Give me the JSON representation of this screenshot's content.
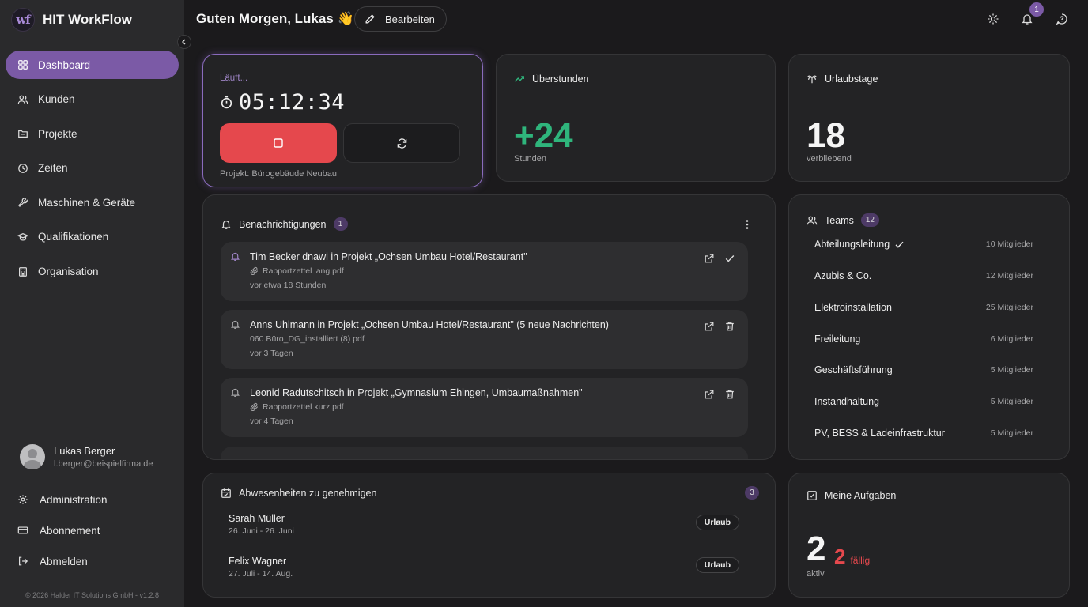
{
  "brand": {
    "logo_text": "wf",
    "name": "HIT WorkFlow"
  },
  "sidebar": {
    "items": [
      {
        "label": "Dashboard",
        "icon": "grid-icon",
        "active": true
      },
      {
        "label": "Kunden",
        "icon": "users-icon"
      },
      {
        "label": "Projekte",
        "icon": "folder-icon"
      },
      {
        "label": "Zeiten",
        "icon": "clock-icon"
      },
      {
        "label": "Maschinen & Geräte",
        "icon": "wrench-icon"
      },
      {
        "label": "Qualifikationen",
        "icon": "graduation-cap-icon"
      },
      {
        "label": "Organisation",
        "icon": "building-icon"
      }
    ],
    "user": {
      "name": "Lukas Berger",
      "email": "l.berger@beispielfirma.de"
    },
    "bottom": [
      {
        "label": "Administration",
        "icon": "gear-icon"
      },
      {
        "label": "Abonnement",
        "icon": "credit-card-icon"
      },
      {
        "label": "Abmelden",
        "icon": "logout-icon"
      }
    ],
    "copyright": "© 2026 Halder IT Solutions GmbH - v1.2.8"
  },
  "header": {
    "greeting": "Guten Morgen, Lukas 👋",
    "edit_label": "Bearbeiten",
    "notification_count": "1"
  },
  "timer": {
    "status": "Läuft...",
    "value": "05:12:34",
    "project": "Projekt: Bürogebäude Neubau"
  },
  "overtime": {
    "title": "Überstunden",
    "value": "+24",
    "sub": "Stunden"
  },
  "vacation": {
    "title": "Urlaubstage",
    "value": "18",
    "sub": "verbliebend"
  },
  "notifications": {
    "title": "Benachrichtigungen",
    "count": "1",
    "items": [
      {
        "title": "Tim Becker dnawi in Projekt „Ochsen Umbau Hotel/Restaurant\"",
        "file": "Rapportzettel lang.pdf",
        "time": "vor etwa 18 Stunden",
        "action": "check"
      },
      {
        "title": "Anns Uhlmann in Projekt „Ochsen Umbau Hotel/Restaurant\" (5 neue Nachrichten)",
        "file": "060 Büro_DG_installiert (8) pdf",
        "time": "vor 3 Tagen",
        "action": "trash"
      },
      {
        "title": "Leonid Radutschitsch in Projekt „Gymnasium Ehingen, Umbaumaßnahmen\"",
        "file": "Rapportzettel kurz.pdf",
        "time": "vor 4 Tagen",
        "action": "trash"
      }
    ]
  },
  "teams": {
    "title": "Teams",
    "count": "12",
    "items": [
      {
        "name": "Abteilungsleitung",
        "members": "10 Mitglieder",
        "selected": true
      },
      {
        "name": "Azubis & Co.",
        "members": "12 Mitglieder"
      },
      {
        "name": "Elektroinstallation",
        "members": "25 Mitglieder"
      },
      {
        "name": "Freileitung",
        "members": "6 Mitglieder"
      },
      {
        "name": "Geschäftsführung",
        "members": "5 Mitglieder"
      },
      {
        "name": "Instandhaltung",
        "members": "5 Mitglieder"
      },
      {
        "name": "PV, BESS & Ladeinfrastruktur",
        "members": "5 Mitglieder"
      }
    ]
  },
  "absences": {
    "title": "Abwesenheiten zu genehmigen",
    "count": "3",
    "items": [
      {
        "name": "Sarah Müller",
        "dates": "26. Juni - 26. Juni",
        "type": "Urlaub"
      },
      {
        "name": "Felix Wagner",
        "dates": "27. Juli - 14. Aug.",
        "type": "Urlaub"
      }
    ]
  },
  "tasks": {
    "title": "Meine Aufgaben",
    "active": "2",
    "due": "2",
    "due_label": "fällig",
    "sub": "aktiv"
  },
  "colors": {
    "accent": "#7b5aa6",
    "danger": "#e5484d",
    "success": "#2fb57c",
    "background": "#1b1a1c",
    "card": "#232325"
  }
}
